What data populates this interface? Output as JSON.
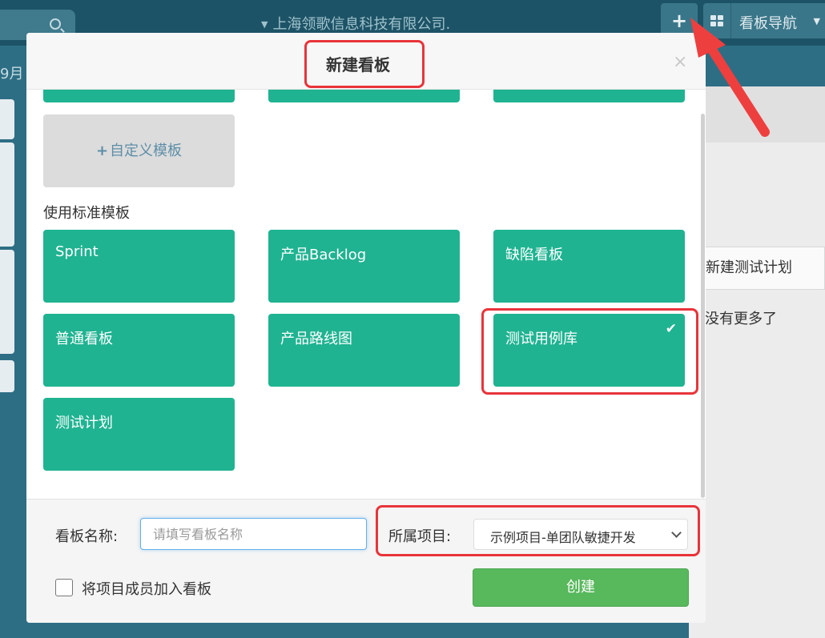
{
  "topbar": {
    "company": "上海领歌信息科技有限公司.",
    "add_icon": "plus-icon",
    "nav_label": "看板导航"
  },
  "background": {
    "date_fragment": "9月",
    "right_panel": {
      "button_label": "新建测试计划",
      "empty_text": "没有更多了"
    }
  },
  "modal": {
    "title": "新建看板",
    "close_symbol": "×",
    "custom_template_label": "自定义模板",
    "standard_section_title": "使用标准模板",
    "templates": [
      {
        "label": "Sprint",
        "selected": false
      },
      {
        "label": "产品Backlog",
        "selected": false
      },
      {
        "label": "缺陷看板",
        "selected": false
      },
      {
        "label": "普通看板",
        "selected": false
      },
      {
        "label": "产品路线图",
        "selected": false
      },
      {
        "label": "测试用例库",
        "selected": true
      },
      {
        "label": "测试计划",
        "selected": false
      }
    ],
    "footer": {
      "name_label": "看板名称:",
      "name_value": "",
      "name_placeholder": "请填写看板名称",
      "project_label": "所属项目:",
      "project_value": "示例项目-单团队敏捷开发",
      "add_members_label": "将项目成员加入看板",
      "add_members_checked": false,
      "create_label": "创建"
    }
  },
  "colors": {
    "tile": "#1fb391",
    "create_button": "#58b85c",
    "highlight": "#e8343a",
    "topbar": "#1d5366"
  }
}
